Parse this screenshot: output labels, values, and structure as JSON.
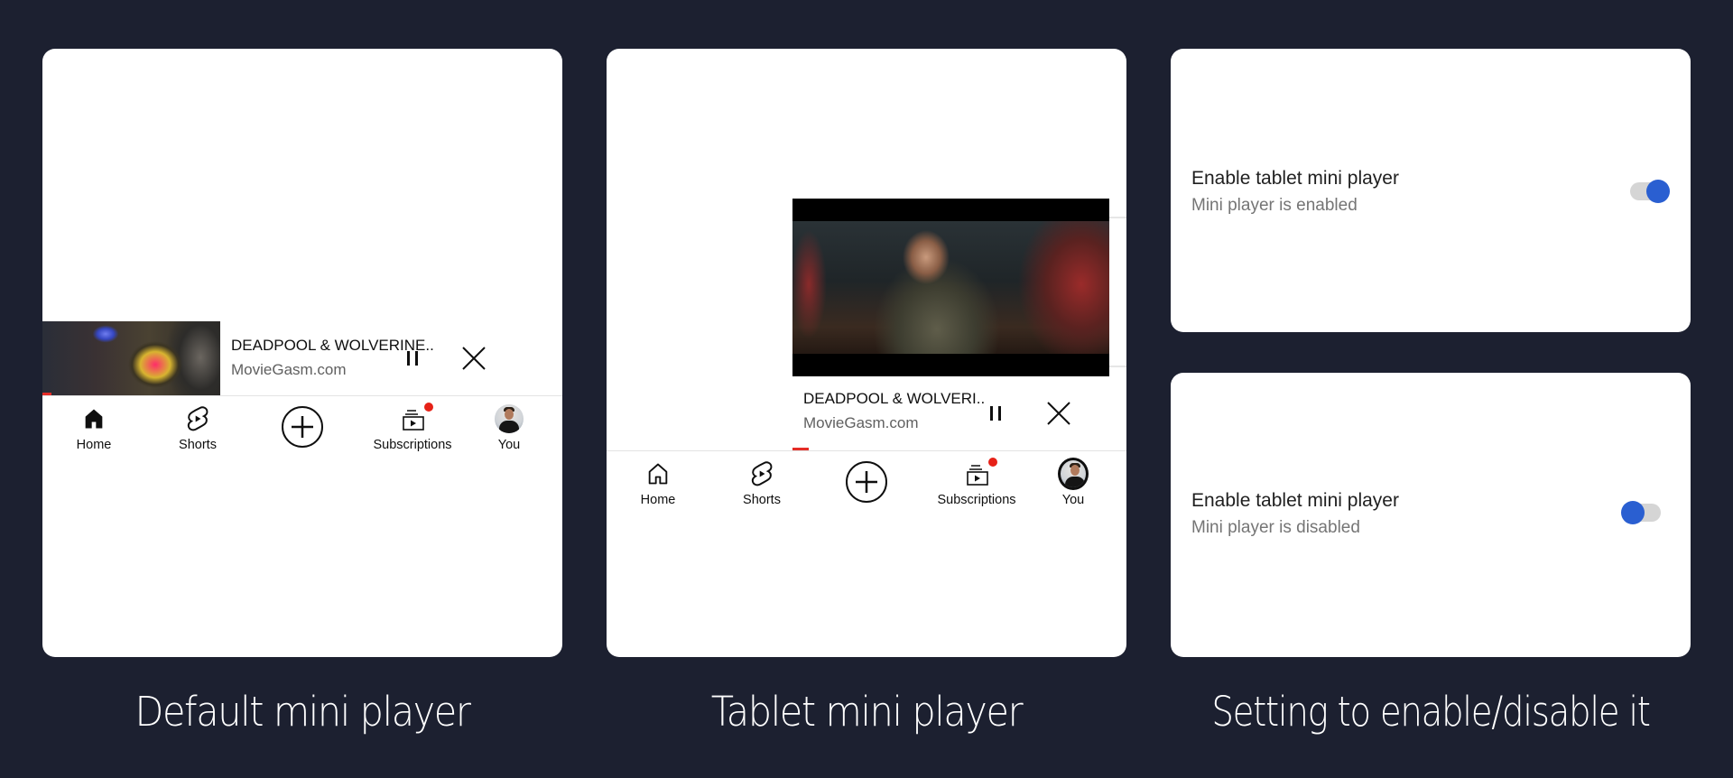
{
  "captions": {
    "default": "Default mini player",
    "tablet": "Tablet mini player",
    "setting": "Setting to enable/disable it"
  },
  "default_player": {
    "title": "DEADPOOL & WOLVERINE..",
    "channel": "MovieGasm.com",
    "pause_icon": "pause-icon",
    "close_icon": "close-icon"
  },
  "tablet_player": {
    "title": "DEADPOOL & WOLVERI..",
    "channel": "MovieGasm.com",
    "pause_icon": "pause-icon",
    "close_icon": "close-icon"
  },
  "nav": {
    "items": [
      {
        "label": "Home",
        "icon": "home-icon"
      },
      {
        "label": "Shorts",
        "icon": "shorts-icon"
      },
      {
        "label": "",
        "icon": "create-plus-icon"
      },
      {
        "label": "Subscriptions",
        "icon": "subscriptions-icon",
        "badge": true
      },
      {
        "label": "You",
        "icon": "avatar"
      }
    ]
  },
  "settings": [
    {
      "title": "Enable tablet mini player",
      "subtitle": "Mini player is enabled",
      "state": "on"
    },
    {
      "title": "Enable tablet mini player",
      "subtitle": "Mini player is disabled",
      "state": "off"
    }
  ],
  "colors": {
    "background": "#1c2030",
    "accent_blue": "#2a5fd1",
    "youtube_red": "#e62117"
  }
}
